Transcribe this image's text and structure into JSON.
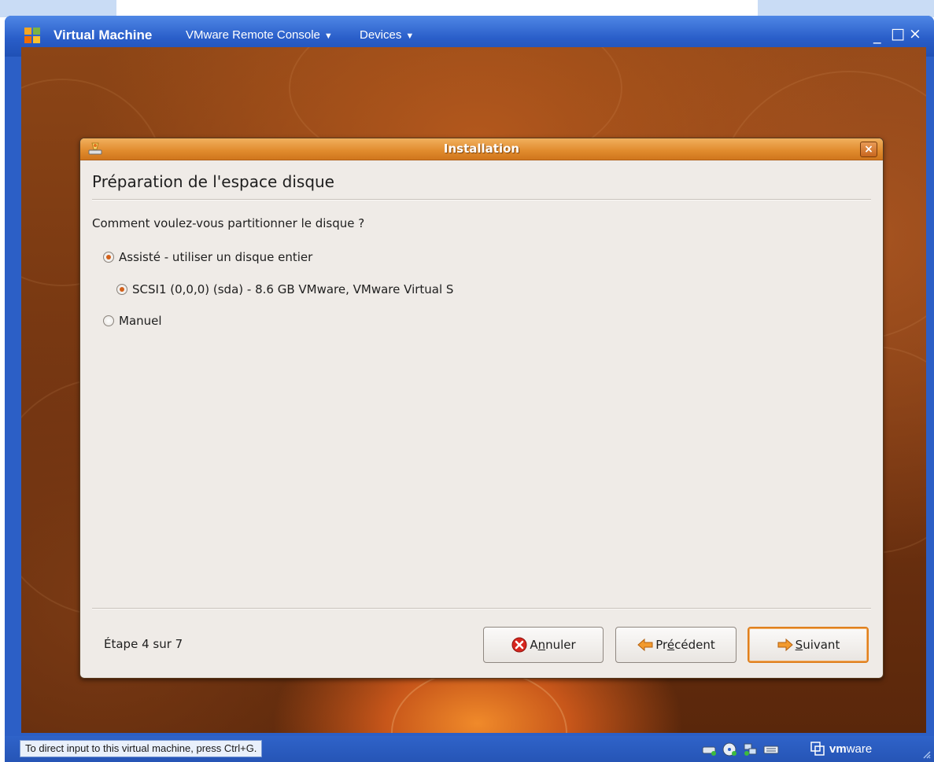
{
  "vm_window": {
    "title": "Virtual Machine",
    "menus": [
      {
        "label": "VMware Remote Console"
      },
      {
        "label": "Devices"
      }
    ],
    "controls": {
      "minimize": "_",
      "maximize": "□",
      "close": "×"
    }
  },
  "dialog": {
    "title": "Installation",
    "close_glyph": "×",
    "heading": "Préparation de l'espace disque",
    "question": "Comment voulez-vous partitionner le disque ?",
    "options": [
      {
        "label": "Assisté - utiliser un disque entier",
        "checked": true
      },
      {
        "label": "SCSI1 (0,0,0) (sda) - 8.6 GB VMware, VMware Virtual S",
        "checked": true
      },
      {
        "label": "Manuel",
        "checked": false
      }
    ],
    "step": "Étape 4 sur 7",
    "buttons": {
      "cancel": {
        "prefix": "A",
        "mnemonic": "n",
        "suffix": "nuler"
      },
      "back": {
        "prefix": "Pr",
        "mnemonic": "é",
        "suffix": "cédent"
      },
      "next": {
        "prefix": "",
        "mnemonic": "S",
        "suffix": "uivant"
      }
    }
  },
  "statusbar": {
    "message": "To direct input to this virtual machine, press Ctrl+G.",
    "logo": {
      "bold": "vm",
      "rest": "ware"
    },
    "device_icons": [
      "hard-disk-icon",
      "cd-rom-icon",
      "network-icon",
      "keyboard-icon"
    ]
  },
  "colors": {
    "accent_orange": "#e0801e",
    "xp_blue": "#2c5fc6",
    "dialog_bg": "#efebe7"
  }
}
